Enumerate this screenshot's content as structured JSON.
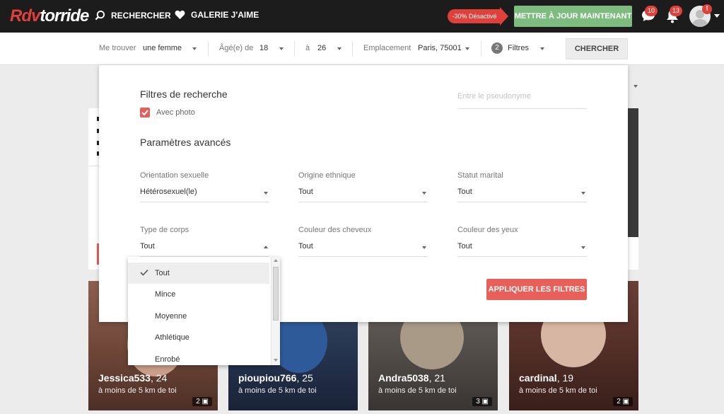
{
  "topbar": {
    "logo_part1": "Rdv",
    "logo_part2": "torride",
    "nav_search": "RECHERCHER",
    "nav_gallery": "GALERIE J'AIME",
    "promo": "-30% Désactivé",
    "upgrade": "METTRE À JOUR MAINTENANT",
    "messages_count": "10",
    "notifications_count": "13",
    "alert": "!"
  },
  "searchbar": {
    "find_label": "Me trouver",
    "find_value": "une femme",
    "age_label": "Âgé(e) de",
    "age_from": "18",
    "age_to_label": "à",
    "age_to": "26",
    "location_label": "Emplacement",
    "location_value": "Paris, 75001",
    "filters_count": "2",
    "filters_label": "Filtres",
    "search_button": "CHERCHER"
  },
  "panel": {
    "title": "Filtres de recherche",
    "with_photo": "Avec photo",
    "pseudo_placeholder": "Entre le pseudonyme",
    "advanced": "Paramètres avancés",
    "fields": {
      "orientation": {
        "label": "Orientation sexuelle",
        "value": "Hétérosexuel(le)"
      },
      "ethnic": {
        "label": "Origine ethnique",
        "value": "Tout"
      },
      "marital": {
        "label": "Statut marital",
        "value": "Tout"
      },
      "body": {
        "label": "Type de corps",
        "value": "Tout"
      },
      "hair": {
        "label": "Couleur des cheveux",
        "value": "Tout"
      },
      "eyes": {
        "label": "Couleur des yeux",
        "value": "Tout"
      }
    },
    "apply": "APPLIQUER LES FILTRES"
  },
  "dropdown": {
    "options": [
      "Tout",
      "Mince",
      "Moyenne",
      "Athlétique",
      "Enrobé"
    ],
    "selected": "Tout"
  },
  "profiles": [
    {
      "name": "Jessica533",
      "age": ", 24",
      "distance": "à moins de 5 km de toi",
      "photos": "2"
    },
    {
      "name": "pioupiou766",
      "age": ", 25",
      "distance": "à moins de 5 km de toi",
      "photos": ""
    },
    {
      "name": "Andra5038",
      "age": ", 21",
      "distance": "à moins de 5 km de toi",
      "photos": "3"
    },
    {
      "name": "cardinal",
      "age": ", 19",
      "distance": "à moins de 5 km de toi",
      "photos": "2"
    }
  ],
  "colors": {
    "accent": "#e0403a",
    "upgrade": "#7dbb7f",
    "apply": "#e8605a",
    "topbar": "#1c1c1c"
  }
}
